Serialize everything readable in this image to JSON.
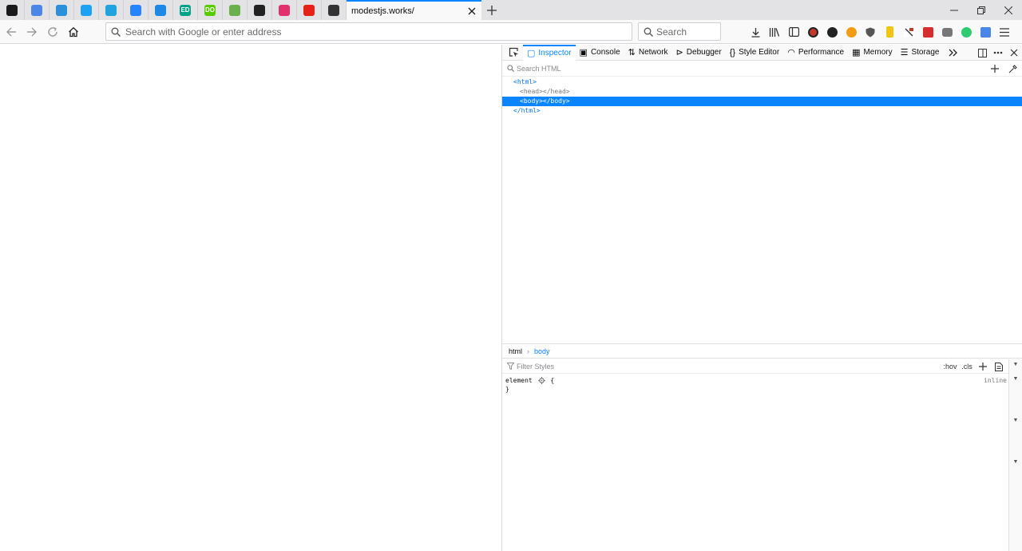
{
  "tabs": {
    "pinned": [
      {
        "icon": "keepass-icon",
        "label": "",
        "color": "#1a1a1a"
      },
      {
        "icon": "translate-icon",
        "label": "",
        "color": "#4a86e8"
      },
      {
        "icon": "mastodon-icon",
        "label": "",
        "color": "#2b90d9"
      },
      {
        "icon": "twitter-icon",
        "label": "",
        "color": "#1da1f2"
      },
      {
        "icon": "wordpress-icon",
        "label": "",
        "color": "#21a3df"
      },
      {
        "icon": "jira-icon",
        "label": "",
        "color": "#2684ff"
      },
      {
        "icon": "pocket-icon",
        "label": "",
        "color": "#1e88e5"
      },
      {
        "icon": "edx-icon",
        "label": "ED",
        "color": "#02a388"
      },
      {
        "icon": "duolingo-icon",
        "label": "DO",
        "color": "#58cc02"
      },
      {
        "icon": "leaf-icon",
        "label": "",
        "color": "#6ab04c"
      },
      {
        "icon": "media-audio-icon",
        "label": "",
        "color": "#222222"
      },
      {
        "icon": "instagram-icon",
        "label": "",
        "color": "#e1306c"
      },
      {
        "icon": "youtube-icon",
        "label": "",
        "color": "#e62117"
      },
      {
        "icon": "github-cat-icon",
        "label": "",
        "color": "#333333"
      }
    ],
    "active": {
      "title": "modestjs.works/"
    }
  },
  "navbar": {
    "url_placeholder": "Search with Google or enter address",
    "search_placeholder": "Search"
  },
  "devtools": {
    "tabs": [
      {
        "label": "Inspector",
        "icon": "inspector-icon",
        "glyph": "▢",
        "selected": true
      },
      {
        "label": "Console",
        "icon": "console-icon",
        "glyph": "▣",
        "selected": false
      },
      {
        "label": "Network",
        "icon": "network-icon",
        "glyph": "⇅",
        "selected": false
      },
      {
        "label": "Debugger",
        "icon": "debugger-icon",
        "glyph": "⊳",
        "selected": false
      },
      {
        "label": "Style Editor",
        "icon": "style-editor-icon",
        "glyph": "{}",
        "selected": false
      },
      {
        "label": "Performance",
        "icon": "performance-icon",
        "glyph": "◠",
        "selected": false
      },
      {
        "label": "Memory",
        "icon": "memory-icon",
        "glyph": "▦",
        "selected": false
      },
      {
        "label": "Storage",
        "icon": "storage-icon",
        "glyph": "☰",
        "selected": false
      }
    ],
    "markup_search_placeholder": "Search HTML",
    "markup": {
      "html_open": "<html>",
      "head": "<head></head>",
      "body": "<body></body>",
      "html_close": "</html>"
    },
    "breadcrumbs": [
      "html",
      "body"
    ],
    "rules": {
      "filter_placeholder": "Filter Styles",
      "hov": ":hov",
      "cls": ".cls",
      "selector": "element",
      "open_brace": "{",
      "close_brace": "}",
      "source": "inline"
    }
  },
  "colors": {
    "accent": "#0a84ff",
    "tabstrip": "#e3e3e5",
    "toolbar": "#f9f9fa"
  }
}
